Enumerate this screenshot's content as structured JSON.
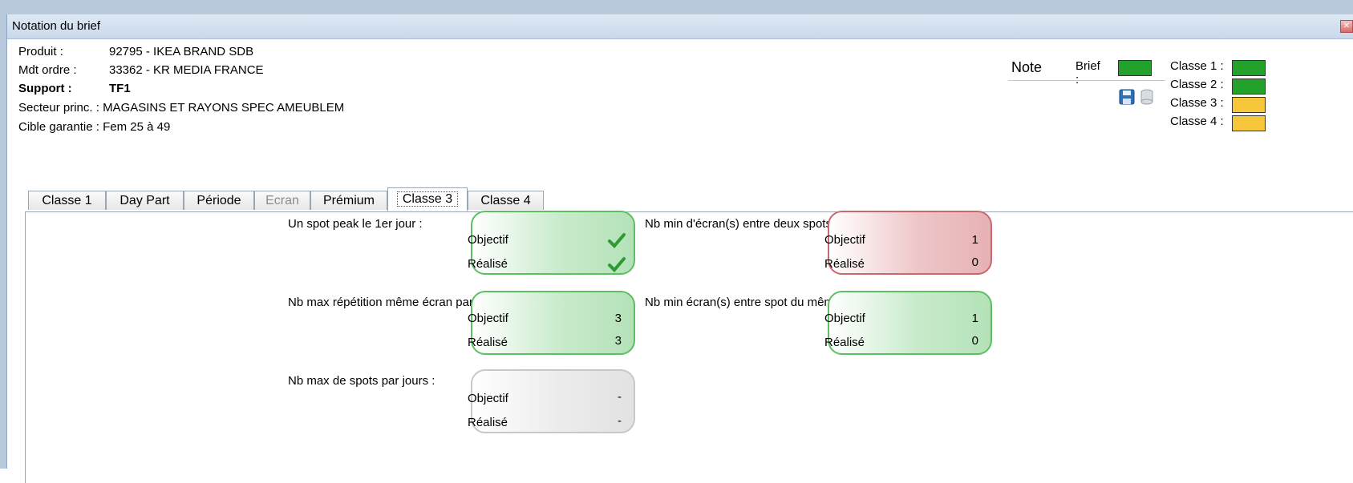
{
  "window": {
    "title": "Notation du brief",
    "close_icon": "close-icon"
  },
  "info": {
    "produit_label": "Produit :",
    "produit_value": "92795 - IKEA BRAND SDB",
    "mdt_label": "Mdt ordre :",
    "mdt_value": "33362 - KR MEDIA FRANCE",
    "support_label": "Support :",
    "support_value": "TF1",
    "secteur_label": "Secteur princ. :",
    "secteur_value": "MAGASINS ET RAYONS SPEC AMEUBLEM",
    "cible_label": "Cible garantie :",
    "cible_value": "Fem 25 à 49"
  },
  "note": {
    "title": "Note",
    "brief_label": "Brief :",
    "brief_color": "#22a22a",
    "save_icon": "save-icon",
    "db_icon": "database-icon"
  },
  "classes": [
    {
      "label": "Classe 1 :",
      "color": "#22a22a"
    },
    {
      "label": "Classe 2 :",
      "color": "#22a22a"
    },
    {
      "label": "Classe 3 :",
      "color": "#f6c73a"
    },
    {
      "label": "Classe 4 :",
      "color": "#f6c73a"
    }
  ],
  "tabs": [
    {
      "label": "Classe 1",
      "state": "normal"
    },
    {
      "label": "Day Part",
      "state": "normal"
    },
    {
      "label": "Période",
      "state": "normal"
    },
    {
      "label": "Ecran",
      "state": "disabled"
    },
    {
      "label": "Prémium",
      "state": "normal"
    },
    {
      "label": "Classe 3",
      "state": "active"
    },
    {
      "label": "Classe 4",
      "state": "normal"
    }
  ],
  "criteria": {
    "objectif_label": "Objectif",
    "realise_label": "Réalisé",
    "spot_peak": {
      "label": "Un spot peak le 1er jour :",
      "objectif": "✔",
      "realise": "✔",
      "status": "good"
    },
    "nb_min_ecran": {
      "label": "Nb min d'écran(s) entre deux spots :",
      "objectif": "1",
      "realise": "0",
      "status": "bad"
    },
    "nb_max_repet": {
      "label": "Nb max répétition même écran par jours :",
      "objectif": "3",
      "realise": "3",
      "status": "good"
    },
    "nb_min_ecran_produit": {
      "label": "Nb min écran(s) entre spot du même produit :",
      "objectif": "1",
      "realise": "0",
      "status": "good"
    },
    "nb_max_spots": {
      "label": "Nb max de spots par jours :",
      "objectif": "-",
      "realise": "-",
      "status": "neutral"
    }
  }
}
